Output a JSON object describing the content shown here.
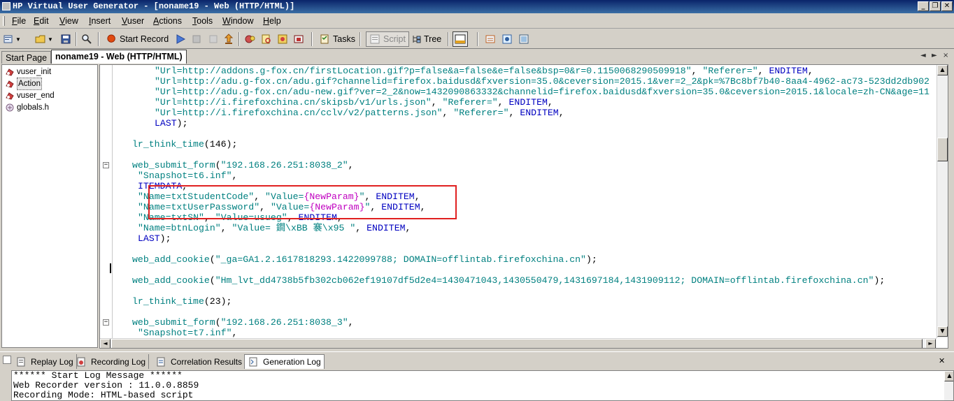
{
  "window": {
    "title": "HP Virtual User Generator - [noname19 - Web (HTTP/HTML)]",
    "controls": [
      "minimize",
      "restore",
      "close"
    ]
  },
  "menu": [
    "File",
    "Edit",
    "View",
    "Insert",
    "Vuser",
    "Actions",
    "Tools",
    "Window",
    "Help"
  ],
  "toolbar": {
    "start_record": "Start Record",
    "tasks": "Tasks",
    "script": "Script",
    "tree": "Tree"
  },
  "doc_tabs": {
    "start_page": "Start Page",
    "active": "noname19 - Web (HTTP/HTML)",
    "nav": [
      "◄",
      "►",
      "×"
    ]
  },
  "tree_items": [
    {
      "label": "vuser_init",
      "icon": "action-icon"
    },
    {
      "label": "Action",
      "icon": "action-icon",
      "selected": true
    },
    {
      "label": "vuser_end",
      "icon": "action-icon"
    },
    {
      "label": "globals.h",
      "icon": "header-file-icon"
    }
  ],
  "code_lines": [
    [
      [
        "s",
        "\"Url=http://addons.g-fox.cn/firstLocation.gif?p=false&a=false&e=false&bsp=0&r=0.1150068290509918\""
      ],
      [
        "t",
        ", "
      ],
      [
        "s",
        "\"Referer=\""
      ],
      [
        "t",
        ", "
      ],
      [
        "k",
        "ENDITEM"
      ],
      [
        "t",
        ","
      ]
    ],
    [
      [
        "s",
        "\"Url=http://adu.g-fox.cn/adu.gif?channelid=firefox.baidusd&fxversion=35.0&ceversion=2015.1&ver=2_2&pk=%7Bc8bf7b40-8aa4-4962-ac73-523dd2db902"
      ]
    ],
    [
      [
        "s",
        "\"Url=http://adu.g-fox.cn/adu-new.gif?ver=2_2&now=1432090863332&channelid=firefox.baidusd&fxversion=35.0&ceversion=2015.1&locale=zh-CN&age=11"
      ]
    ],
    [
      [
        "s",
        "\"Url=http://i.firefoxchina.cn/skipsb/v1/urls.json\""
      ],
      [
        "t",
        ", "
      ],
      [
        "s",
        "\"Referer=\""
      ],
      [
        "t",
        ", "
      ],
      [
        "k",
        "ENDITEM"
      ],
      [
        "t",
        ","
      ]
    ],
    [
      [
        "s",
        "\"Url=http://i.firefoxchina.cn/cclv/v2/patterns.json\""
      ],
      [
        "t",
        ", "
      ],
      [
        "s",
        "\"Referer=\""
      ],
      [
        "t",
        ", "
      ],
      [
        "k",
        "ENDITEM"
      ],
      [
        "t",
        ","
      ]
    ],
    [
      [
        "k",
        "LAST"
      ],
      [
        "t",
        ");"
      ]
    ],
    [],
    [
      [
        "f",
        "lr_think_time"
      ],
      [
        "t",
        "(146);"
      ]
    ],
    [],
    [
      [
        "f",
        "web_submit_form"
      ],
      [
        "t",
        "("
      ],
      [
        "s",
        "\"192.168.26.251:8038_2\""
      ],
      [
        "t",
        ","
      ]
    ],
    [
      [
        "s",
        "\"Snapshot=t6.inf\""
      ],
      [
        "t",
        ","
      ]
    ],
    [
      [
        "k",
        "ITEMDATA"
      ],
      [
        "t",
        ","
      ]
    ],
    [
      [
        "s",
        "\"Name=txtStudentCode\""
      ],
      [
        "t",
        ", "
      ],
      [
        "s",
        "\"Value="
      ],
      [
        "p",
        "{NewParam}"
      ],
      [
        "s",
        "\""
      ],
      [
        "t",
        ", "
      ],
      [
        "k",
        "ENDITEM"
      ],
      [
        "t",
        ","
      ]
    ],
    [
      [
        "s",
        "\"Name=txtUserPassword\""
      ],
      [
        "t",
        ", "
      ],
      [
        "s",
        "\"Value="
      ],
      [
        "p",
        "{NewParam}"
      ],
      [
        "s",
        "\""
      ],
      [
        "t",
        ", "
      ],
      [
        "k",
        "ENDITEM"
      ],
      [
        "t",
        ","
      ]
    ],
    [
      [
        "s",
        "\"Name=txtSN\""
      ],
      [
        "t",
        ", "
      ],
      [
        "s",
        "\"Value=usueg\""
      ],
      [
        "t",
        ", "
      ],
      [
        "k",
        "ENDITEM"
      ],
      [
        "t",
        ","
      ]
    ],
    [
      [
        "s",
        "\"Name=btnLogin\""
      ],
      [
        "t",
        ", "
      ],
      [
        "s",
        "\"Value= 鐧\\xBB 褰\\x95 \""
      ],
      [
        "t",
        ", "
      ],
      [
        "k",
        "ENDITEM"
      ],
      [
        "t",
        ","
      ]
    ],
    [
      [
        "k",
        "LAST"
      ],
      [
        "t",
        ");"
      ]
    ],
    [],
    [
      [
        "f",
        "web_add_cookie"
      ],
      [
        "t",
        "("
      ],
      [
        "s",
        "\"_ga=GA1.2.1617818293.1422099788; DOMAIN=offlintab.firefoxchina.cn\""
      ],
      [
        "t",
        ");"
      ]
    ],
    [],
    [
      [
        "f",
        "web_add_cookie"
      ],
      [
        "t",
        "("
      ],
      [
        "s",
        "\"Hm_lvt_dd4738b5fb302cb062ef19107df5d2e4=1430471043,1430550479,1431697184,1431909112; DOMAIN=offlintab.firefoxchina.cn\""
      ],
      [
        "t",
        ");"
      ]
    ],
    [],
    [
      [
        "f",
        "lr_think_time"
      ],
      [
        "t",
        "(23);"
      ]
    ],
    [],
    [
      [
        "f",
        "web_submit_form"
      ],
      [
        "t",
        "("
      ],
      [
        "s",
        "\"192.168.26.251:8038_3\""
      ],
      [
        "t",
        ","
      ]
    ],
    [
      [
        "s",
        "\"Snapshot=t7.inf\""
      ],
      [
        "t",
        ","
      ]
    ]
  ],
  "log_tabs": [
    "Replay Log",
    "Recording Log",
    "Correlation Results",
    "Generation Log"
  ],
  "active_log_tab": "Generation Log",
  "log_lines": [
    "****** Start Log Message ******",
    "Web Recorder version : 11.0.0.8859",
    "Recording Mode: HTML-based script"
  ],
  "colors": {
    "string": "#008080",
    "keyword": "#0000c0",
    "param": "#c000c0",
    "highlight_box": "#e02020"
  }
}
